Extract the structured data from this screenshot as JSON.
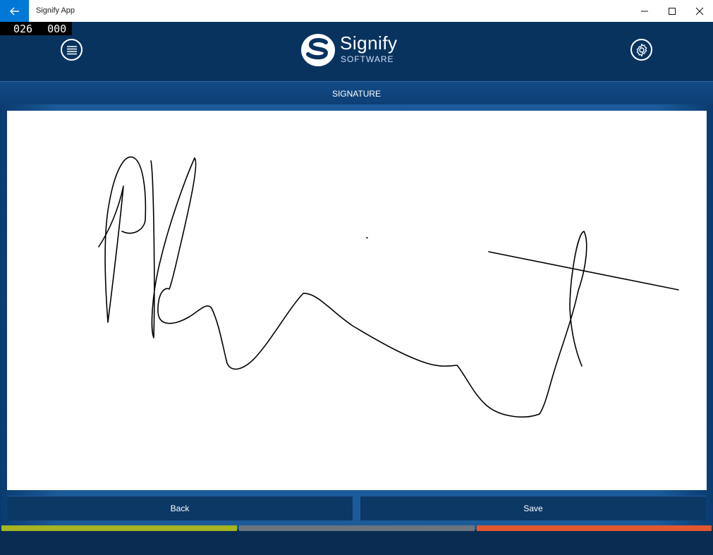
{
  "window": {
    "title": "Signify App"
  },
  "counter": {
    "left": "026",
    "right": "000"
  },
  "header": {
    "logo_main": "Signify",
    "logo_sub": "SOFTWARE",
    "menu_icon": "hamburger-menu-icon",
    "settings_icon": "gear-icon"
  },
  "page": {
    "title": "SIGNATURE"
  },
  "buttons": {
    "back_label": "Back",
    "save_label": "Save"
  },
  "colors": {
    "accent_blue": "#0078d7",
    "header_bg": "#09335f",
    "strip_green": "#a5b420",
    "strip_gray": "#6b7480",
    "strip_orange": "#e2572f"
  }
}
